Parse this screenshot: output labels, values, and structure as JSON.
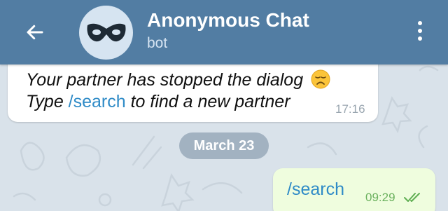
{
  "header": {
    "title": "Anonymous Chat",
    "subtitle": "bot",
    "back_icon": "arrow-left-icon",
    "avatar_icon": "mask-icon",
    "menu_icon": "kebab-menu-icon",
    "color": "#527da3"
  },
  "messages": {
    "incoming": {
      "line1": "Your partner has stopped the dialog",
      "line1_emoji": "disappointed-face-emoji",
      "line2_prefix": "Type ",
      "line2_command": "/search",
      "line2_suffix": " to find a new partner",
      "time": "17:16"
    },
    "date_separator": "March 23",
    "outgoing": {
      "text": "/search",
      "time": "09:29",
      "status_icon": "double-check-icon",
      "bubble_color": "#effdde"
    }
  },
  "colors": {
    "link": "#2f8bc7",
    "chat_background": "#d9e2ea"
  }
}
